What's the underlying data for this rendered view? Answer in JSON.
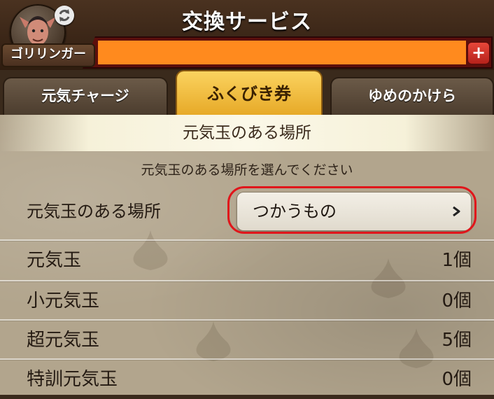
{
  "header": {
    "title": "交換サービス",
    "player_name": "ゴリリンガー",
    "avatar_icon": "character-avatar-icon",
    "swap_icon": "swap-character-icon",
    "plus_symbol": "+"
  },
  "tabs": [
    {
      "label": "元気チャージ",
      "active": false
    },
    {
      "label": "ふくびき券",
      "active": true
    },
    {
      "label": "ゆめのかけら",
      "active": false
    }
  ],
  "section": {
    "title": "元気玉のある場所",
    "instruction": "元気玉のある場所を選んでください"
  },
  "location": {
    "label": "元気玉のある場所",
    "selected": "つかうもの",
    "arrow_icon": "chevron-right-icon"
  },
  "items": [
    {
      "name": "元気玉",
      "count": "1個"
    },
    {
      "name": "小元気玉",
      "count": "0個"
    },
    {
      "name": "超元気玉",
      "count": "5個"
    },
    {
      "name": "特訓元気玉",
      "count": "0個"
    }
  ],
  "colors": {
    "gauge": "#ff8a1e",
    "active_tab": "#f2bd3c",
    "highlight_outline": "#e0161b"
  }
}
